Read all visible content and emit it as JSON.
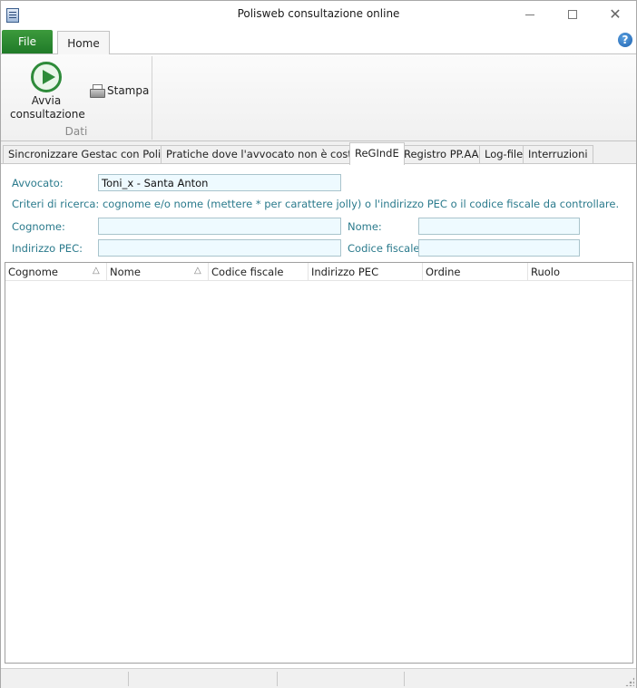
{
  "window": {
    "title": "Polisweb consultazione online"
  },
  "ribbon": {
    "file_tab": "File",
    "home_tab": "Home",
    "avvia_label_1": "Avvia",
    "avvia_label_2": "consultazione",
    "stampa_label": "Stampa",
    "group_label": "Dati",
    "help_glyph": "?"
  },
  "tabs": [
    {
      "label": "Sincronizzare Gestac con Polisweb"
    },
    {
      "label": "Pratiche dove l'avvocato non è costituito"
    },
    {
      "label": "ReGIndE",
      "active": true
    },
    {
      "label": "Registro PP.AA."
    },
    {
      "label": "Log-file"
    },
    {
      "label": "Interruzioni"
    }
  ],
  "form": {
    "avvocato_label": "Avvocato:",
    "avvocato_value": "Toni_x - Santa Anton",
    "criteria_text": "Criteri di ricerca: cognome e/o nome (mettere * per carattere jolly) o l'indirizzo PEC o il codice fiscale da controllare.",
    "cognome_label": "Cognome:",
    "cognome_value": "",
    "nome_label": "Nome:",
    "nome_value": "",
    "pec_label": "Indirizzo PEC:",
    "pec_value": "",
    "cf_label": "Codice fiscale:",
    "cf_value": ""
  },
  "grid": {
    "columns": [
      "Cognome",
      "Nome",
      "Codice fiscale",
      "Indirizzo PEC",
      "Ordine",
      "Ruolo"
    ],
    "sort_glyph": "△",
    "rows": []
  },
  "colors": {
    "file_tab": "#2e8b3a",
    "label_text": "#2a7a8c",
    "field_bg": "#eefaff"
  }
}
